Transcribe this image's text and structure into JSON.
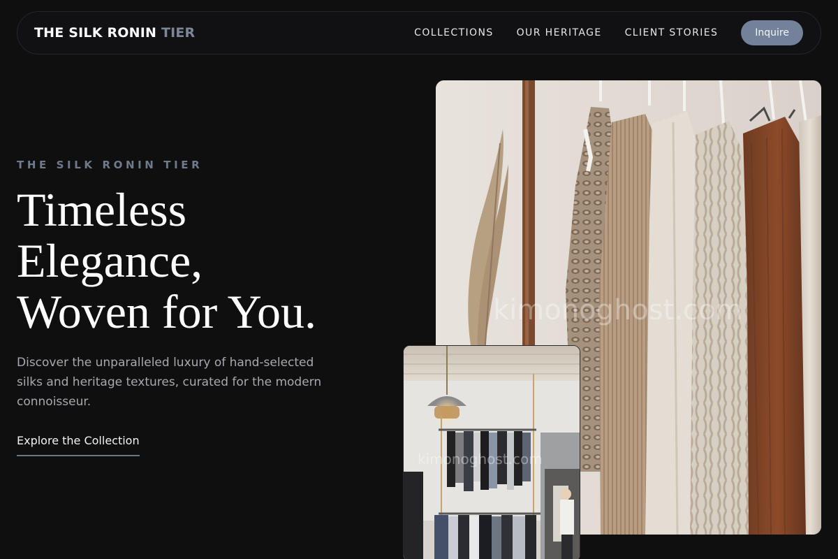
{
  "nav": {
    "brand_main": "THE SILK RONIN",
    "brand_accent": "TIER",
    "links": [
      "COLLECTIONS",
      "OUR HERITAGE",
      "CLIENT STORIES"
    ],
    "cta_label": "Inquire"
  },
  "hero": {
    "eyebrow": "THE SILK RONIN TIER",
    "headline_lines": [
      "Timeless",
      "Elegance,",
      "Woven for You."
    ],
    "description": "Discover the unparalleled luxury of hand-selected silks and heritage textures, curated for the modern connoisseur.",
    "cta_label": "Explore the Collection"
  },
  "images": {
    "main_watermark": "kimonoghost.com",
    "inset_watermark": "kimonoghost.com"
  },
  "colors": {
    "background": "#0f0f10",
    "accent": "#74819a",
    "eyebrow": "#6f7b8c"
  }
}
